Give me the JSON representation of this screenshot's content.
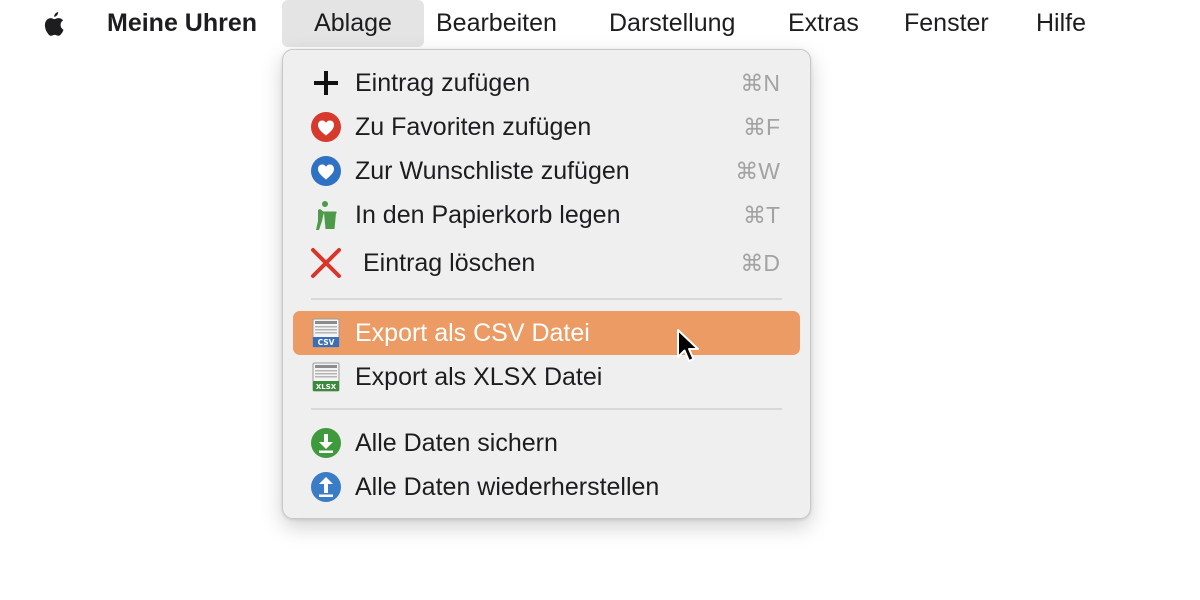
{
  "menubar": {
    "apple_icon": "apple-logo-icon",
    "app_name": "Meine Uhren",
    "menus": [
      "Ablage",
      "Bearbeiten",
      "Darstellung",
      "Extras",
      "Fenster",
      "Hilfe"
    ],
    "open_menu": "Ablage"
  },
  "dropdown": {
    "items": [
      {
        "icon": "plus-icon",
        "label": "Eintrag zufügen",
        "shortcut": "⌘N"
      },
      {
        "icon": "heart-red-icon",
        "label": "Zu Favoriten zufügen",
        "shortcut": "⌘F"
      },
      {
        "icon": "heart-blue-icon",
        "label": "Zur Wunschliste zufügen",
        "shortcut": "⌘W"
      },
      {
        "icon": "trash-icon",
        "label": "In den Papierkorb legen",
        "shortcut": "⌘T"
      },
      {
        "icon": "delete-x-icon",
        "label": "Eintrag löschen",
        "shortcut": "⌘D"
      },
      {
        "icon": "csv-file-icon",
        "icon_text": "CSV",
        "label": "Export als CSV Datei",
        "highlighted": true
      },
      {
        "icon": "xlsx-file-icon",
        "icon_text": "XLSX",
        "label": "Export als XLSX Datei"
      },
      {
        "icon": "download-icon",
        "label": "Alle Daten sichern"
      },
      {
        "icon": "upload-icon",
        "label": "Alle Daten wiederherstellen"
      }
    ]
  },
  "colors": {
    "highlight": "#eb9b63",
    "menu_background": "#efefef",
    "heart_red": "#d63a2c",
    "heart_blue": "#2f72c4",
    "trash_green": "#4d9a48",
    "delete_red": "#d8362b",
    "download_green": "#3f9a3d",
    "upload_blue": "#3a7cc5"
  }
}
